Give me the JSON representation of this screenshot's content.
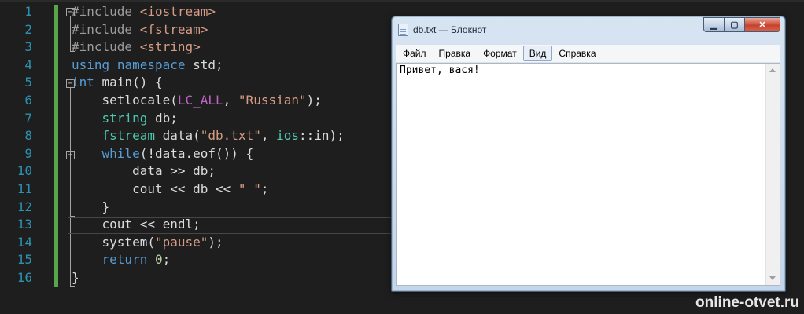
{
  "editor": {
    "line_numbers": [
      "1",
      "2",
      "3",
      "4",
      "5",
      "6",
      "7",
      "8",
      "9",
      "10",
      "11",
      "12",
      "13",
      "14",
      "15",
      "16"
    ],
    "lines": [
      [
        {
          "t": "#include ",
          "c": "pre"
        },
        {
          "t": "<iostream>",
          "c": "inc"
        }
      ],
      [
        {
          "t": "#include ",
          "c": "pre"
        },
        {
          "t": "<fstream>",
          "c": "inc"
        }
      ],
      [
        {
          "t": "#include ",
          "c": "pre"
        },
        {
          "t": "<string>",
          "c": "inc"
        }
      ],
      [
        {
          "t": "using",
          "c": "kw"
        },
        {
          "t": " "
        },
        {
          "t": "namespace",
          "c": "kw"
        },
        {
          "t": " std;"
        }
      ],
      [
        {
          "t": "int",
          "c": "kw"
        },
        {
          "t": " main() {"
        }
      ],
      [
        {
          "t": "    setlocale("
        },
        {
          "t": "LC_ALL",
          "c": "mac"
        },
        {
          "t": ", "
        },
        {
          "t": "\"Russian\"",
          "c": "str"
        },
        {
          "t": ");"
        }
      ],
      [
        {
          "t": "    "
        },
        {
          "t": "string",
          "c": "typ"
        },
        {
          "t": " db;"
        }
      ],
      [
        {
          "t": "    "
        },
        {
          "t": "fstream",
          "c": "typ"
        },
        {
          "t": " data("
        },
        {
          "t": "\"db.txt\"",
          "c": "str"
        },
        {
          "t": ", "
        },
        {
          "t": "ios",
          "c": "typ"
        },
        {
          "t": "::in);"
        }
      ],
      [
        {
          "t": "    "
        },
        {
          "t": "while",
          "c": "kw"
        },
        {
          "t": "(!data.eof()) {"
        }
      ],
      [
        {
          "t": "        data >> db;"
        }
      ],
      [
        {
          "t": "        cout << db << "
        },
        {
          "t": "\" \"",
          "c": "str"
        },
        {
          "t": ";"
        }
      ],
      [
        {
          "t": "    }"
        }
      ],
      [
        {
          "t": "    cout << endl;"
        }
      ],
      [
        {
          "t": "    system("
        },
        {
          "t": "\"pause\"",
          "c": "str"
        },
        {
          "t": ");"
        }
      ],
      [
        {
          "t": "    "
        },
        {
          "t": "return",
          "c": "kw"
        },
        {
          "t": " "
        },
        {
          "t": "0",
          "c": "num"
        },
        {
          "t": ";"
        }
      ],
      [
        {
          "t": "}"
        }
      ]
    ],
    "current_line": 13,
    "colors": {
      "background": "#1e1e1e",
      "line_number": "#2b91af",
      "keyword": "#569cd6",
      "string": "#d69d85",
      "macro": "#bd63c5",
      "type": "#4ec9b0",
      "change_bar": "#57a64a"
    }
  },
  "notepad": {
    "title": "db.txt — Блокнот",
    "icon": "notepad-icon",
    "menu": [
      "Файл",
      "Правка",
      "Формат",
      "Вид",
      "Справка"
    ],
    "menu_hover_index": 3,
    "content": "Привет, вася!",
    "buttons": {
      "min": "minimize-icon",
      "max": "maximize-icon",
      "close": "close-icon"
    }
  },
  "watermark": "online-otvet.ru"
}
